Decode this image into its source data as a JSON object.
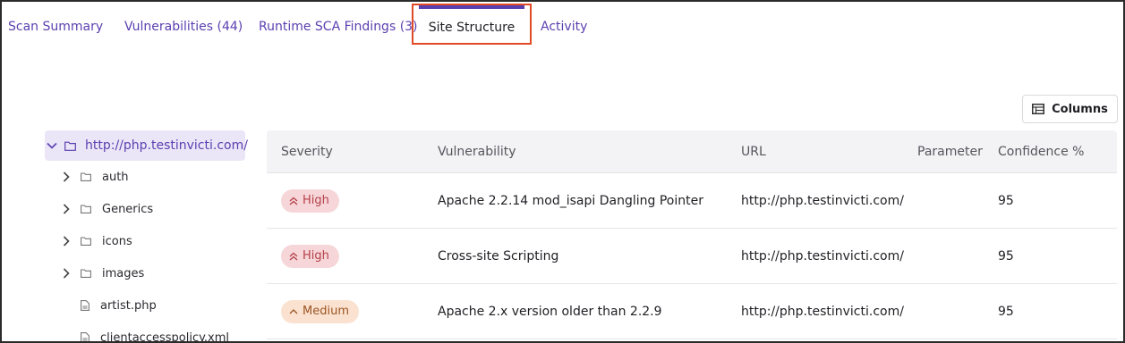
{
  "tabs": [
    {
      "label": "Scan Summary"
    },
    {
      "label": "Vulnerabilities (44)"
    },
    {
      "label": "Runtime SCA Findings (3)"
    },
    {
      "label": "Site Structure"
    },
    {
      "label": "Activity"
    }
  ],
  "active_tab": "Site Structure",
  "toolbar": {
    "columns_label": "Columns",
    "columns_icon": "table-columns-icon"
  },
  "tree": {
    "root": {
      "label": "http://php.testinvicti.com/",
      "expanded": true
    },
    "items": [
      {
        "label": "auth",
        "type": "folder"
      },
      {
        "label": "Generics",
        "type": "folder"
      },
      {
        "label": "icons",
        "type": "folder"
      },
      {
        "label": "images",
        "type": "folder"
      },
      {
        "label": "artist.php",
        "type": "file"
      },
      {
        "label": "clientaccesspolicy.xml",
        "type": "file"
      }
    ]
  },
  "table": {
    "headers": {
      "severity": "Severity",
      "vulnerability": "Vulnerability",
      "url": "URL",
      "parameter": "Parameter",
      "confidence": "Confidence %"
    },
    "rows": [
      {
        "severity": "High",
        "vulnerability": "Apache 2.2.14 mod_isapi Dangling Pointer",
        "url": "http://php.testinvicti.com/",
        "parameter": "",
        "confidence": "95"
      },
      {
        "severity": "High",
        "vulnerability": "Cross-site Scripting",
        "url": "http://php.testinvicti.com/",
        "parameter": "",
        "confidence": "95"
      },
      {
        "severity": "Medium",
        "vulnerability": "Apache 2.x version older than 2.2.9",
        "url": "http://php.testinvicti.com/",
        "parameter": "",
        "confidence": "95"
      }
    ]
  },
  "colors": {
    "accent": "#5b3fb0",
    "active_tab_border": "#e04a26",
    "high_bg": "#f6d6d8",
    "high_text": "#b5404a",
    "medium_bg": "#fbe2d0",
    "medium_text": "#9a5423"
  }
}
